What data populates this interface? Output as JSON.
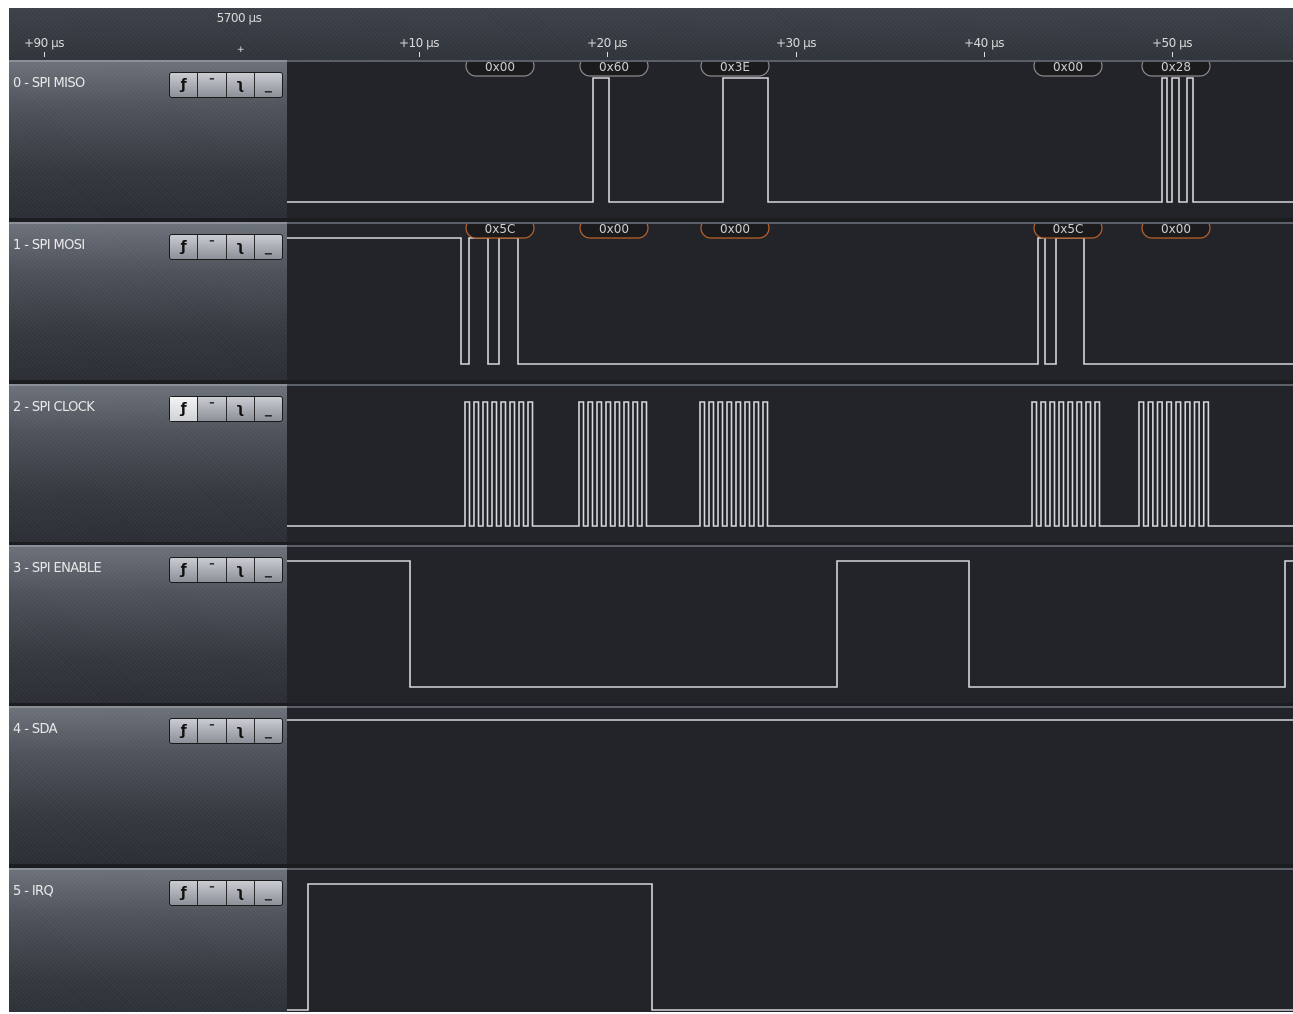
{
  "ruler": {
    "reference_time": "5700 µs",
    "ticks": [
      "+90 µs",
      "+10 µs",
      "+20 µs",
      "+30 µs",
      "+40 µs",
      "+50 µs"
    ]
  },
  "icons": {
    "rising_edge": "rising-edge-icon",
    "high_level": "high-level-icon",
    "falling_edge": "falling-edge-icon",
    "low_level": "low-level-icon"
  },
  "colors": {
    "background": "#1c1d21",
    "plot_background": "#23242a",
    "trace": "#d7d8dc",
    "byte_bubble_fill": "#1b1b1e",
    "mosi_bubble_border": "#b9632a",
    "miso_bubble_border": "#8a8a8a"
  },
  "channels": [
    {
      "id": "ch0",
      "label": "0 - SPI MISO",
      "decoded": [
        "0x00",
        "0x60",
        "0x3E",
        "0x00",
        "0x28"
      ]
    },
    {
      "id": "ch1",
      "label": "1 - SPI MOSI",
      "decoded": [
        "0x5C",
        "0x00",
        "0x00",
        "0x5C",
        "0x00"
      ]
    },
    {
      "id": "ch2",
      "label": "2 - SPI CLOCK",
      "decoded": []
    },
    {
      "id": "ch3",
      "label": "3 - SPI ENABLE",
      "decoded": []
    },
    {
      "id": "ch4",
      "label": "4 - SDA",
      "decoded": []
    },
    {
      "id": "ch5",
      "label": "5 - IRQ",
      "decoded": []
    }
  ]
}
